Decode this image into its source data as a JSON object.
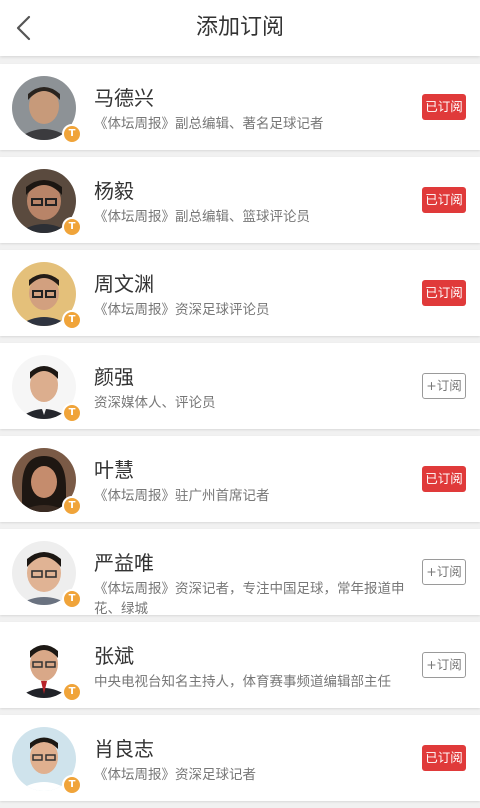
{
  "header": {
    "title": "添加订阅",
    "back_icon": "chevron-left-icon"
  },
  "badge_glyph": "T",
  "colors": {
    "subscribed_bg": "#e03a3a",
    "badge": "#f0a43a"
  },
  "subscribers": [
    {
      "name": "马德兴",
      "desc": "《体坛周报》副总编辑、著名足球记者",
      "status": "已订阅",
      "subscribed": true
    },
    {
      "name": "杨毅",
      "desc": "《体坛周报》副总编辑、篮球评论员",
      "status": "已订阅",
      "subscribed": true
    },
    {
      "name": "周文渊",
      "desc": "《体坛周报》资深足球评论员",
      "status": "已订阅",
      "subscribed": true
    },
    {
      "name": "颜强",
      "desc": "资深媒体人、评论员",
      "status": "+订阅",
      "subscribed": false
    },
    {
      "name": "叶慧",
      "desc": "《体坛周报》驻广州首席记者",
      "status": "已订阅",
      "subscribed": true
    },
    {
      "name": "严益唯",
      "desc": "《体坛周报》资深记者，专注中国足球，常年报道申花、绿城",
      "status": "+订阅",
      "subscribed": false
    },
    {
      "name": "张斌",
      "desc": "中央电视台知名主持人，体育赛事频道编辑部主任",
      "status": "+订阅",
      "subscribed": false
    },
    {
      "name": "肖良志",
      "desc": "《体坛周报》资深足球记者",
      "status": "已订阅",
      "subscribed": true
    }
  ]
}
